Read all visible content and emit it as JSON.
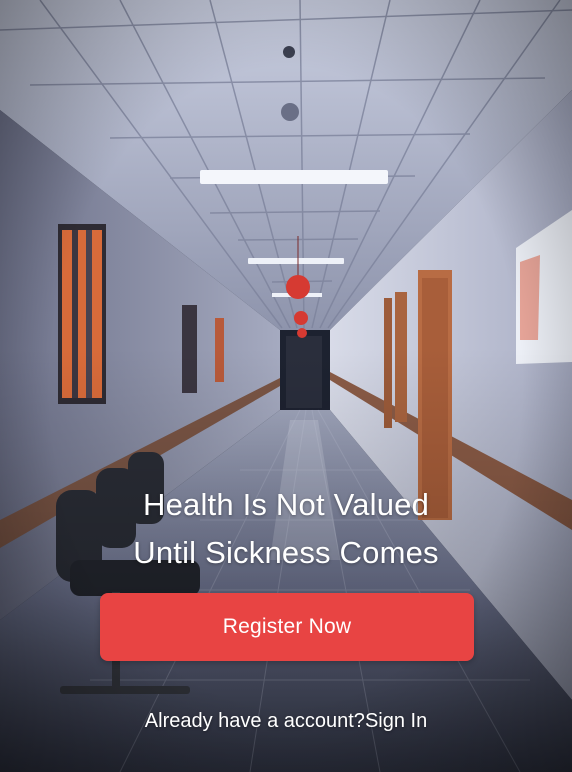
{
  "hero": {
    "tagline_line1": "Health Is Not Valued",
    "tagline_line2": "Until  Sickness Comes"
  },
  "actions": {
    "register_label": "Register Now",
    "account_prompt": "Already have a account?",
    "signin_label": "Sign In"
  },
  "colors": {
    "accent": "#e84443",
    "text": "#ffffff"
  }
}
